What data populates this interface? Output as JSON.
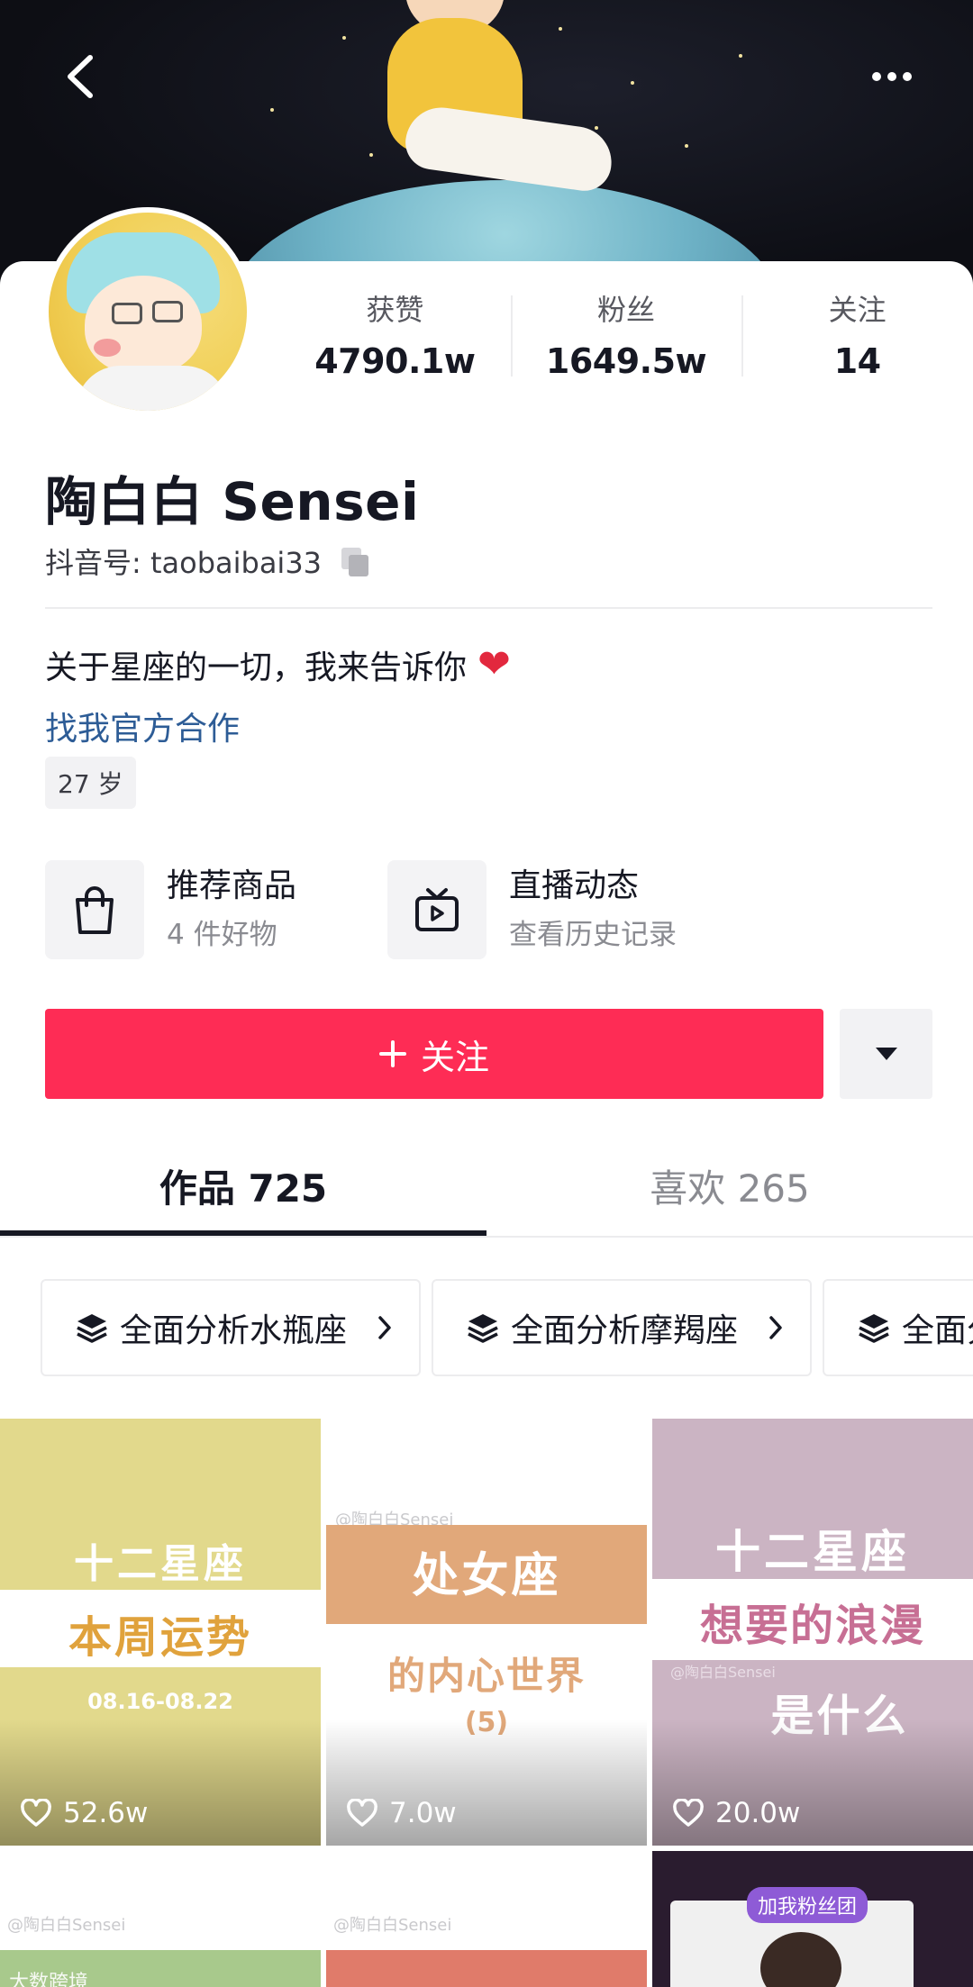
{
  "header": {
    "back_icon": "back-chevron-icon",
    "more_icon": "more-dots-icon"
  },
  "stats": [
    {
      "label": "获赞",
      "value": "4790.1w"
    },
    {
      "label": "粉丝",
      "value": "1649.5w"
    },
    {
      "label": "关注",
      "value": "14"
    }
  ],
  "profile": {
    "name": "陶白白 Sensei",
    "douyin_id": "抖音号: taobaibai33",
    "bio": "关于星座的一切，我来告诉你",
    "cooperation_link": "找我官方合作",
    "age_tag": "27 岁"
  },
  "features": [
    {
      "title": "推荐商品",
      "subtitle": "4 件好物",
      "icon": "shopping-bag-icon"
    },
    {
      "title": "直播动态",
      "subtitle": "查看历史记录",
      "icon": "tv-play-icon"
    }
  ],
  "actions": {
    "follow_label": "关注",
    "follow_color": "#fe2c55"
  },
  "tabs": [
    {
      "label": "作品 725",
      "active": true
    },
    {
      "label": "喜欢 265",
      "active": false
    }
  ],
  "collections": [
    {
      "label": "全面分析水瓶座"
    },
    {
      "label": "全面分析摩羯座"
    },
    {
      "label": "全面分"
    }
  ],
  "videos": [
    {
      "line1": "十二星座",
      "line2": "本周运势",
      "line3": "08.16-08.22",
      "likes": "52.6w"
    },
    {
      "tag": "@陶白白Sensei",
      "line1": "处女座",
      "line2": "的内心世界",
      "line3": "(5)",
      "likes": "7.0w"
    },
    {
      "tag": "@陶白白Sensei",
      "line1": "十二星座",
      "line2": "想要的浪漫",
      "line3": "是什么",
      "likes": "20.0w"
    },
    {
      "tag": "@陶白白Sensei"
    },
    {
      "tag": "@陶白白Sensei"
    },
    {
      "tag": "加我粉丝团"
    }
  ],
  "watermark": "大数跨境"
}
